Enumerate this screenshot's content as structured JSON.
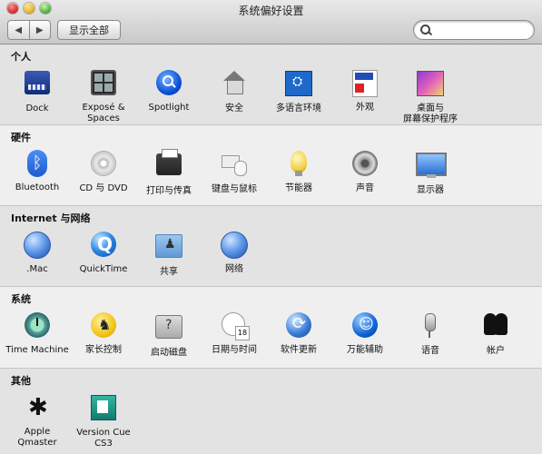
{
  "window": {
    "title": "系统偏好设置",
    "toolbar": {
      "back_icon": "◀",
      "forward_icon": "▶",
      "show_all_label": "显示全部",
      "search_placeholder": ""
    }
  },
  "sections": {
    "personal": {
      "title": "个人",
      "items": [
        {
          "label": "Dock",
          "icon": "dock-icon"
        },
        {
          "label": "Exposé &\nSpaces",
          "icon": "expose-spaces-icon"
        },
        {
          "label": "Spotlight",
          "icon": "spotlight-icon"
        },
        {
          "label": "安全",
          "icon": "security-icon"
        },
        {
          "label": "多语言环境",
          "icon": "international-icon"
        },
        {
          "label": "外观",
          "icon": "appearance-icon"
        },
        {
          "label": "桌面与\n屏幕保护程序",
          "icon": "desktop-screensaver-icon"
        }
      ]
    },
    "hardware": {
      "title": "硬件",
      "items": [
        {
          "label": "Bluetooth",
          "icon": "bluetooth-icon"
        },
        {
          "label": "CD 与 DVD",
          "icon": "cd-dvd-icon"
        },
        {
          "label": "打印与传真",
          "icon": "print-fax-icon"
        },
        {
          "label": "键盘与鼠标",
          "icon": "keyboard-mouse-icon"
        },
        {
          "label": "节能器",
          "icon": "energy-saver-icon"
        },
        {
          "label": "声音",
          "icon": "sound-icon"
        },
        {
          "label": "显示器",
          "icon": "displays-icon"
        }
      ]
    },
    "internet": {
      "title": "Internet 与网络",
      "items": [
        {
          "label": ".Mac",
          "icon": "dotmac-icon"
        },
        {
          "label": "QuickTime",
          "icon": "quicktime-icon"
        },
        {
          "label": "共享",
          "icon": "sharing-icon"
        },
        {
          "label": "网络",
          "icon": "network-icon"
        }
      ]
    },
    "system": {
      "title": "系统",
      "items": [
        {
          "label": "Time Machine",
          "icon": "time-machine-icon"
        },
        {
          "label": "家长控制",
          "icon": "parental-controls-icon"
        },
        {
          "label": "启动磁盘",
          "icon": "startup-disk-icon"
        },
        {
          "label": "日期与时间",
          "icon": "date-time-icon"
        },
        {
          "label": "软件更新",
          "icon": "software-update-icon"
        },
        {
          "label": "万能辅助",
          "icon": "universal-access-icon"
        },
        {
          "label": "语音",
          "icon": "speech-icon"
        },
        {
          "label": "帐户",
          "icon": "accounts-icon"
        }
      ]
    },
    "other": {
      "title": "其他",
      "items": [
        {
          "label": "Apple\nQmaster",
          "icon": "apple-qmaster-icon"
        },
        {
          "label": "Version Cue\nCS3",
          "icon": "version-cue-icon"
        }
      ]
    }
  }
}
